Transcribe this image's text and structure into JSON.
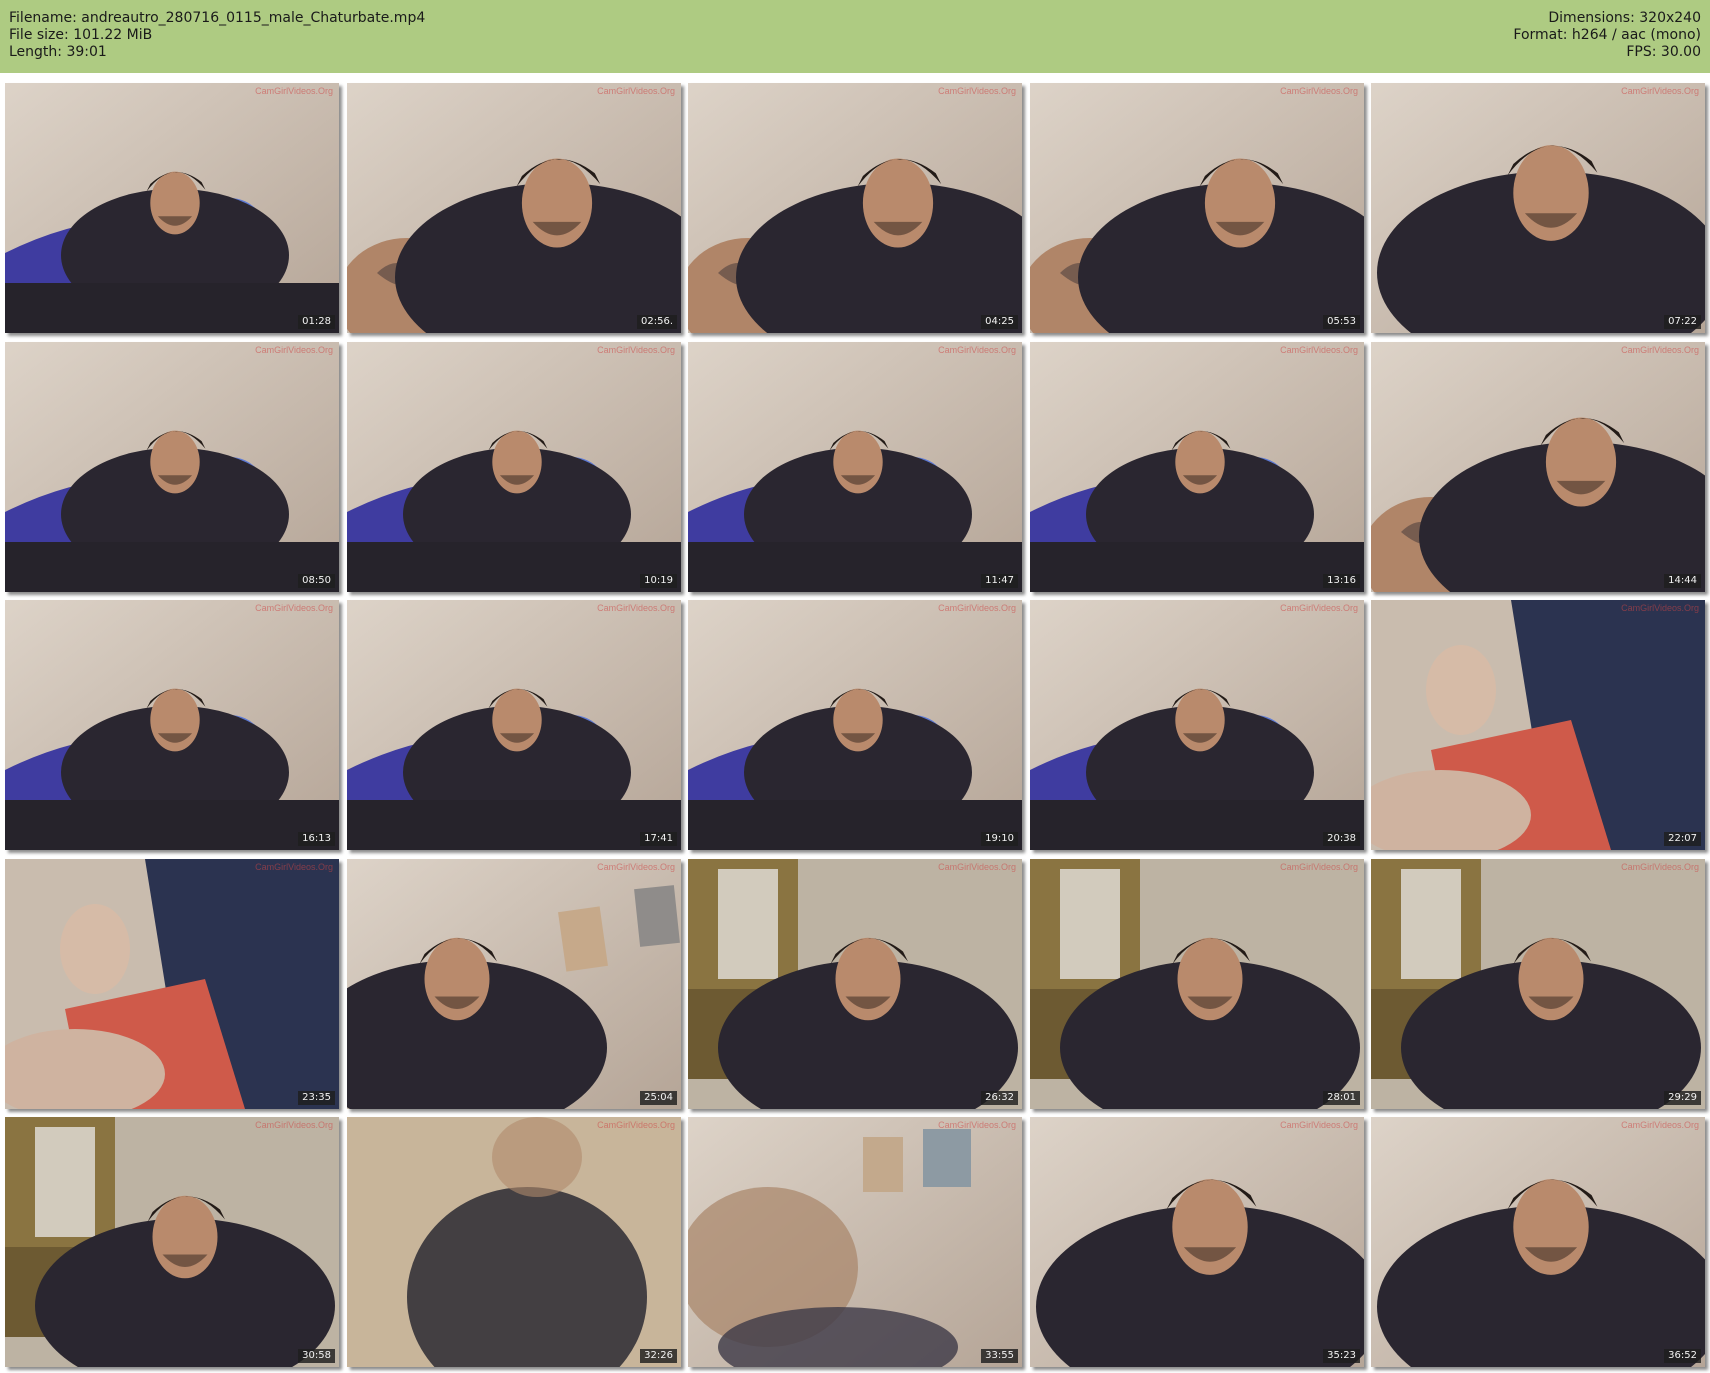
{
  "header": {
    "filename": "Filename: andreautro_280716_0115_male_Chaturbate.mp4",
    "filesize": "File size: 101.22 MiB",
    "length": "Length: 39:01",
    "dimensions": "Dimensions: 320x240",
    "format": "Format: h264 / aac (mono)",
    "fps": "FPS: 30.00"
  },
  "colors": {
    "header_bg": "#aecb82",
    "stamp_bg": "#1e1e1e",
    "watermark": "#cd4646"
  },
  "thumbnails": [
    {
      "time": "01:28",
      "watermark": "CamGirlVideos.Org",
      "scene": "bed-blue-pillow"
    },
    {
      "time": "02:56.",
      "watermark": "CamGirlVideos.Org",
      "scene": "close-up-tattoo"
    },
    {
      "time": "04:25",
      "watermark": "CamGirlVideos.Org",
      "scene": "close-up-tattoo"
    },
    {
      "time": "05:53",
      "watermark": "CamGirlVideos.Org",
      "scene": "close-up-tattoo"
    },
    {
      "time": "07:22",
      "watermark": "CamGirlVideos.Org",
      "scene": "close-up"
    },
    {
      "time": "08:50",
      "watermark": "CamGirlVideos.Org",
      "scene": "bed-blue-pillow"
    },
    {
      "time": "10:19",
      "watermark": "CamGirlVideos.Org",
      "scene": "bed-blue-pillow"
    },
    {
      "time": "11:47",
      "watermark": "CamGirlVideos.Org",
      "scene": "bed-blue-pillow"
    },
    {
      "time": "13:16",
      "watermark": "CamGirlVideos.Org",
      "scene": "bed-blue-pillow"
    },
    {
      "time": "14:44",
      "watermark": "CamGirlVideos.Org",
      "scene": "close-up-tattoo"
    },
    {
      "time": "16:13",
      "watermark": "CamGirlVideos.Org",
      "scene": "bed-blue-pillow"
    },
    {
      "time": "17:41",
      "watermark": "CamGirlVideos.Org",
      "scene": "bed-blue-pillow"
    },
    {
      "time": "19:10",
      "watermark": "CamGirlVideos.Org",
      "scene": "bed-blue-pillow"
    },
    {
      "time": "20:38",
      "watermark": "CamGirlVideos.Org",
      "scene": "bed-blue-pillow"
    },
    {
      "time": "22:07",
      "watermark": "CamGirlVideos.Org",
      "scene": "red-shorts"
    },
    {
      "time": "23:35",
      "watermark": "CamGirlVideos.Org",
      "scene": "red-shorts"
    },
    {
      "time": "25:04",
      "watermark": "CamGirlVideos.Org",
      "scene": "wall-pictures"
    },
    {
      "time": "26:32",
      "watermark": "CamGirlVideos.Org",
      "scene": "wardrobe"
    },
    {
      "time": "28:01",
      "watermark": "CamGirlVideos.Org",
      "scene": "wardrobe"
    },
    {
      "time": "29:29",
      "watermark": "CamGirlVideos.Org",
      "scene": "wardrobe"
    },
    {
      "time": "30:58",
      "watermark": "CamGirlVideos.Org",
      "scene": "wardrobe"
    },
    {
      "time": "32:26",
      "watermark": "CamGirlVideos.Org",
      "scene": "blur"
    },
    {
      "time": "33:55",
      "watermark": "CamGirlVideos.Org",
      "scene": "blur-pictures"
    },
    {
      "time": "35:23",
      "watermark": "CamGirlVideos.Org",
      "scene": "close-up"
    },
    {
      "time": "36:52",
      "watermark": "CamGirlVideos.Org",
      "scene": "close-up"
    }
  ]
}
